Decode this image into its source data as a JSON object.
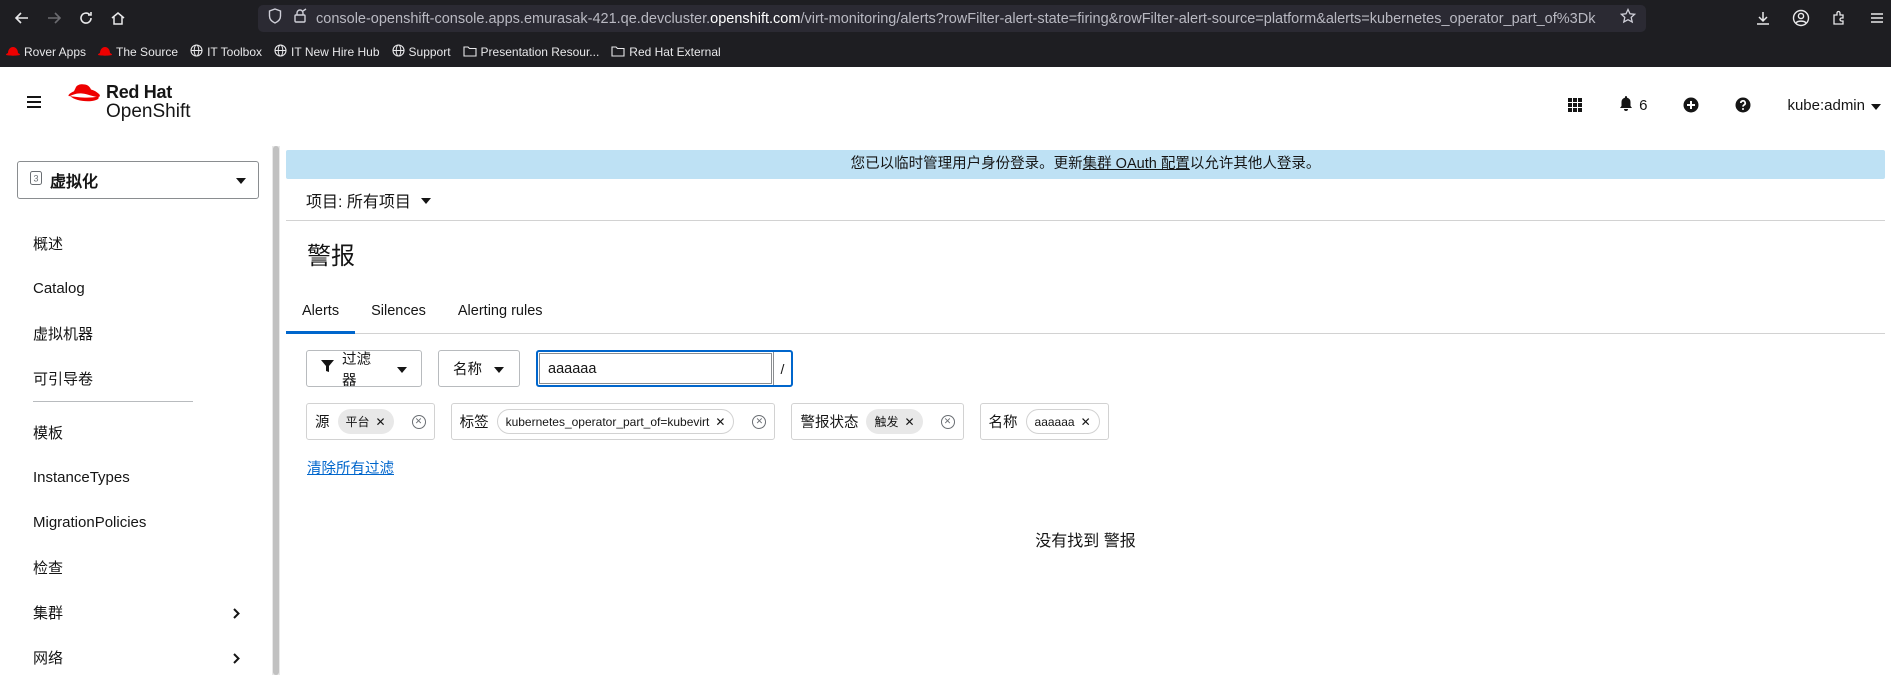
{
  "browser": {
    "url_prefix": "console-openshift-console.apps.emurasak-421.qe.devcluster.",
    "url_domain": "openshift.com",
    "url_suffix": "/virt-monitoring/alerts?rowFilter-alert-state=firing&rowFilter-alert-source=platform&alerts=kubernetes_operator_part_of%3Dk",
    "bookmarks": [
      "Rover Apps",
      "The Source",
      "IT Toolbox",
      "IT New Hire Hub",
      "Support",
      "Presentation Resour...",
      "Red Hat External"
    ]
  },
  "masthead": {
    "logo_line1": "Red Hat",
    "logo_line2": "OpenShift",
    "notification_count": "6",
    "user": "kube:admin"
  },
  "sidebar": {
    "perspective": "虚拟化",
    "items": [
      "概述",
      "Catalog",
      "虚拟机器",
      "可引导卷",
      "模板",
      "InstanceTypes",
      "MigrationPolicies",
      "检查",
      "集群",
      "网络"
    ]
  },
  "main": {
    "banner_prefix": "您已以临时管理用户身份登录。更新",
    "banner_link": "集群 OAuth 配置",
    "banner_suffix": "以允许其他人登录。",
    "project_label": "项目: 所有项目",
    "page_title": "警报",
    "tabs": [
      "Alerts",
      "Silences",
      "Alerting rules"
    ],
    "filter_button": "过滤器",
    "filter_type": "名称",
    "search_value": "aaaaaa",
    "search_hint": "/",
    "chip_groups": [
      {
        "label": "源",
        "chip": "平台"
      },
      {
        "label": "标签",
        "chip": "kubernetes_operator_part_of=kubevirt"
      },
      {
        "label": "警报状态",
        "chip": "触发"
      },
      {
        "label": "名称",
        "chip": "aaaaaa"
      }
    ],
    "clear_filters": "清除所有过滤",
    "empty_message": "没有找到 警报"
  },
  "colors": {
    "accent": "#0066cc",
    "banner": "#bee1f4",
    "redhat_red": "#ee0000",
    "browser_chrome": "#1e1e22"
  }
}
